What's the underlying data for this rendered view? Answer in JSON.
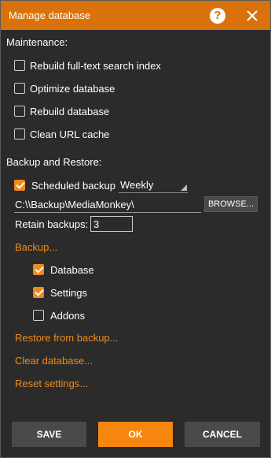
{
  "window": {
    "title": "Manage database",
    "help_icon": "question-circle-icon",
    "close_icon": "close-icon",
    "accent_color": "#d9720a"
  },
  "maintenance": {
    "heading": "Maintenance:",
    "options": [
      {
        "label": "Rebuild full-text search index",
        "checked": false
      },
      {
        "label": "Optimize database",
        "checked": false
      },
      {
        "label": "Rebuild database",
        "checked": false
      },
      {
        "label": "Clean URL cache",
        "checked": false
      }
    ]
  },
  "backup": {
    "heading": "Backup and Restore:",
    "scheduled_label": "Scheduled backup",
    "scheduled_checked": true,
    "frequency_value": "Weekly",
    "path_value": "C:\\\\Backup\\MediaMonkey\\",
    "browse_label": "BROWSE...",
    "retain_label": "Retain backups:",
    "retain_value": "3",
    "backup_link": "Backup...",
    "backup_items": [
      {
        "label": "Database",
        "checked": true
      },
      {
        "label": "Settings",
        "checked": true
      },
      {
        "label": "Addons",
        "checked": false
      }
    ],
    "restore_link": "Restore from backup...",
    "clear_link": "Clear database...",
    "reset_link": "Reset settings..."
  },
  "footer": {
    "save_label": "SAVE",
    "ok_label": "OK",
    "cancel_label": "CANCEL"
  }
}
